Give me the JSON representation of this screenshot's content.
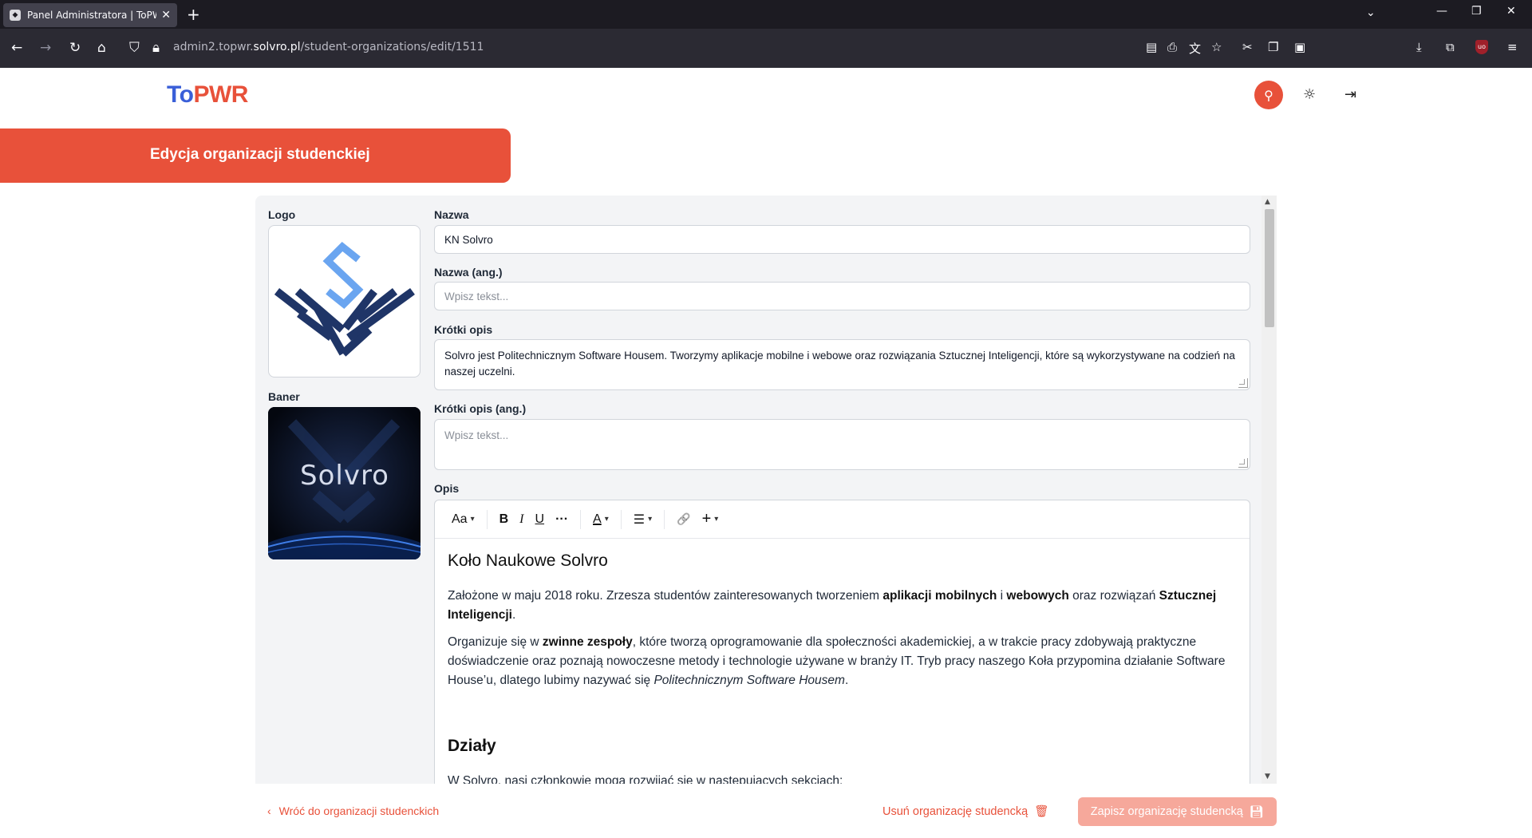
{
  "browser": {
    "tab_title": "Panel Administratora | ToPWR b",
    "url_prefix": "admin2.topwr.",
    "url_domain": "solvro.pl",
    "url_path": "/student-organizations/edit/1511"
  },
  "header": {
    "logo_to": "To",
    "logo_pwr": "PWR"
  },
  "page": {
    "title": "Edycja organizacji studenckiej"
  },
  "form": {
    "logo_label": "Logo",
    "banner_label": "Baner",
    "banner_text": "Solvro",
    "name_label": "Nazwa",
    "name_value": "KN Solvro",
    "name_en_label": "Nazwa (ang.)",
    "name_en_placeholder": "Wpisz tekst...",
    "short_desc_label": "Krótki opis",
    "short_desc_value": "Solvro jest Politechnicznym Software Housem. Tworzymy aplikacje mobilne i webowe oraz rozwiązania Sztucznej Inteligencji, które są wykorzystywane na codzień na naszej uczelni.",
    "short_desc_en_label": "Krótki opis (ang.)",
    "short_desc_en_placeholder": "Wpisz tekst...",
    "desc_label": "Opis"
  },
  "editor": {
    "toolbar": {
      "text_style": "Aa",
      "bold": "B",
      "italic": "I",
      "underline": "U",
      "more": "···",
      "color": "A",
      "list": "☰",
      "link": "🔗",
      "insert": "+"
    },
    "heading1": "Koło Naukowe Solvro",
    "p1_a": "Założone w maju 2018 roku. Zrzesza studentów zainteresowanych tworzeniem ",
    "p1_b": "aplikacji mobilnych",
    "p1_c": " i ",
    "p1_d": "webowych",
    "p1_e": " oraz rozwiązań ",
    "p1_f": "Sztucznej Inteligencji",
    "p1_g": ".",
    "p2_a": "Organizuje się w ",
    "p2_b": "zwinne zespoły",
    "p2_c": ", które tworzą oprogramowanie dla społeczności akademickiej, a w trakcie pracy zdobywają praktyczne doświadczenie oraz poznają nowoczesne metody i technologie używane w branży IT. Tryb pracy naszego Koła przypomina działanie Software House’u, dlatego lubimy nazywać się ",
    "p2_d": "Politechnicznym Software Housem",
    "p2_e": ".",
    "heading2": "Działy",
    "p3": "W Solvro, nasi członkowie mogą rozwijać się w następujących sekcjach:"
  },
  "footer": {
    "back_label": "Wróć do organizacji studenckich",
    "delete_label": "Usuń organizację studencką",
    "save_label": "Zapisz organizację studencką"
  },
  "colors": {
    "accent": "#e8513a",
    "accent_light": "#f6a89b",
    "brand_blue": "#3a5fd8",
    "panel_bg": "#f3f4f6"
  }
}
